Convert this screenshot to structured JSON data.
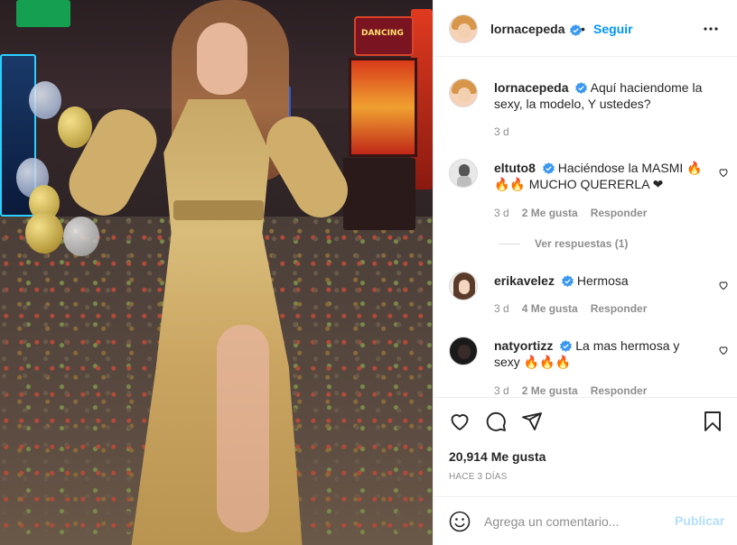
{
  "post": {
    "image_alt": "Woman in golden dress in a casino",
    "slot_sign": "DANCING"
  },
  "header": {
    "username": "lornacepeda",
    "separator": "•",
    "follow_label": "Seguir"
  },
  "caption": {
    "username": "lornacepeda",
    "text": "Aquí haciendome la sexy, la modelo, Y ustedes?",
    "time": "3 d"
  },
  "comments": [
    {
      "username": "eltuto8",
      "text": "Haciéndose la MASMI 🔥🔥🔥 MUCHO QUERERLA ❤",
      "time": "3 d",
      "likes": "2 Me gusta",
      "reply": "Responder"
    },
    {
      "username": "erikavelez",
      "text": "Hermosa",
      "time": "3 d",
      "likes": "4 Me gusta",
      "reply": "Responder"
    },
    {
      "username": "natyortizz",
      "text": "La mas hermosa y sexy 🔥🔥🔥",
      "time": "3 d",
      "likes": "2 Me gusta",
      "reply": "Responder"
    }
  ],
  "view_replies": "Ver respuestas (1)",
  "actions": {
    "like_icon": "heart-icon",
    "comment_icon": "comment-icon",
    "share_icon": "share-icon",
    "save_icon": "bookmark-icon"
  },
  "likes_count": "20,914 Me gusta",
  "date": "HACE 3 DÍAS",
  "add_comment": {
    "placeholder": "Agrega un comentario...",
    "post_label": "Publicar"
  },
  "colors": {
    "accent": "#0095f6",
    "post_disabled": "#b2dffc",
    "muted": "#8e8e8e",
    "text": "#262626"
  }
}
